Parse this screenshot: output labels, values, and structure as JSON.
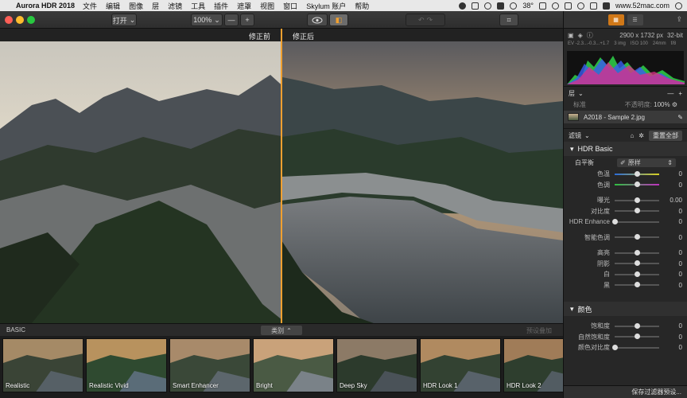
{
  "menubar": {
    "app_name": "Aurora HDR 2018",
    "items": [
      "文件",
      "编辑",
      "图像",
      "层",
      "滤镜",
      "工具",
      "插件",
      "遮罩",
      "视图",
      "窗口",
      "Skylum 账户",
      "帮助"
    ],
    "temperature": "38°",
    "website": "www.52mac.com"
  },
  "toolbar": {
    "open_label": "打开",
    "zoom": "100%",
    "zoom_out": "—",
    "zoom_in": "+"
  },
  "canvas": {
    "before_label": "修正前",
    "after_label": "修正后"
  },
  "filmstrip": {
    "title": "BASIC",
    "category_label": "类别",
    "right_label": "预设叠加",
    "thumbs": [
      {
        "label": "Realistic"
      },
      {
        "label": "Realistic Vivid"
      },
      {
        "label": "Smart Enhancer"
      },
      {
        "label": "Bright"
      },
      {
        "label": "Deep Sky"
      },
      {
        "label": "HDR Look 1"
      },
      {
        "label": "HDR Look 2"
      }
    ]
  },
  "panel": {
    "image_size": "2900 x 1732 px",
    "bit_depth": "32-bit",
    "meta": [
      "EV -2.3...-0.3...+1.7",
      "3 img",
      "ISO 100",
      "24mm",
      "f/8"
    ],
    "layers_title": "层",
    "blend_mode": "标准",
    "opacity_label": "不透明度:",
    "opacity_value": "100%",
    "layer_name": "A2018 - Sample 2.jpg",
    "filters_title": "滤镜",
    "reset_all": "重置全部",
    "filter_basic": "HDR Basic",
    "white_balance_label": "白平衡",
    "white_balance_value": "原样",
    "sliders_a": [
      {
        "label": "色温",
        "value": "0",
        "pos": 0.5
      },
      {
        "label": "色调",
        "value": "0",
        "pos": 0.5
      }
    ],
    "sliders_b": [
      {
        "label": "曝光",
        "value": "0.00",
        "pos": 0.5
      },
      {
        "label": "对比度",
        "value": "0",
        "pos": 0.5
      },
      {
        "label": "HDR Enhance",
        "value": "0",
        "pos": 0.0
      }
    ],
    "sliders_c": [
      {
        "label": "智能色调",
        "value": "0",
        "pos": 0.5
      }
    ],
    "sliders_d": [
      {
        "label": "高亮",
        "value": "0",
        "pos": 0.5
      },
      {
        "label": "阴影",
        "value": "0",
        "pos": 0.5
      },
      {
        "label": "白",
        "value": "0",
        "pos": 0.5
      },
      {
        "label": "黑",
        "value": "0",
        "pos": 0.5
      }
    ],
    "filter_color": "颜色",
    "sliders_color": [
      {
        "label": "饱和度",
        "value": "0",
        "pos": 0.5
      },
      {
        "label": "自然饱和度",
        "value": "0",
        "pos": 0.5
      },
      {
        "label": "颜色对比度",
        "value": "0",
        "pos": 0.0
      }
    ],
    "save_preset": "保存过滤器预设..."
  },
  "colors": {
    "accent": "#f0a030",
    "selected_tab": "#d07818"
  }
}
